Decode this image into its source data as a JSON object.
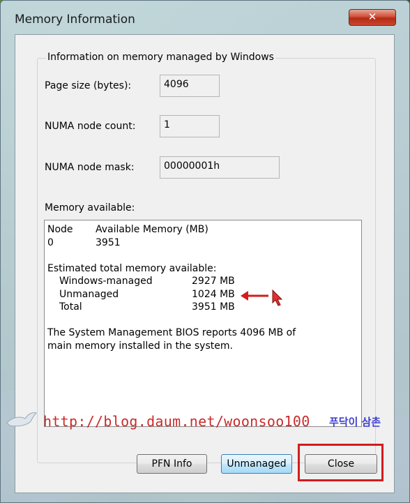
{
  "window": {
    "title": "Memory Information",
    "close_glyph": "✕"
  },
  "group": {
    "label": "Information on memory managed by Windows",
    "page_size_label": "Page size (bytes):",
    "page_size_value": "4096",
    "numa_count_label": "NUMA node count:",
    "numa_count_value": "1",
    "numa_mask_label": "NUMA node mask:",
    "numa_mask_value": "00000001h",
    "memory_available_label": "Memory available:"
  },
  "memory_text": {
    "header_node": "Node",
    "header_available": "Available Memory (MB)",
    "node_id": "0",
    "node_value": "3951",
    "estimated_title": "Estimated total memory available:",
    "rows": [
      {
        "label": "Windows-managed",
        "value": "2927 MB"
      },
      {
        "label": "Unmanaged",
        "value": "1024 MB"
      },
      {
        "label": "Total",
        "value": "3951 MB"
      }
    ],
    "bios_line1": "The System Management BIOS reports 4096 MB of",
    "bios_line2": "main memory installed in the system."
  },
  "watermark": {
    "url": "http://blog.daum.net/woonsoo100",
    "name": "푸닥이 삼촌",
    "icon": "dove-icon"
  },
  "buttons": {
    "pfn_info": "PFN Info",
    "unmanaged": "Unmanaged",
    "close": "Close"
  },
  "colors": {
    "annotation_red": "#d21c1c",
    "watermark_url": "#cc2a2a",
    "watermark_name": "#3f3fd0"
  }
}
